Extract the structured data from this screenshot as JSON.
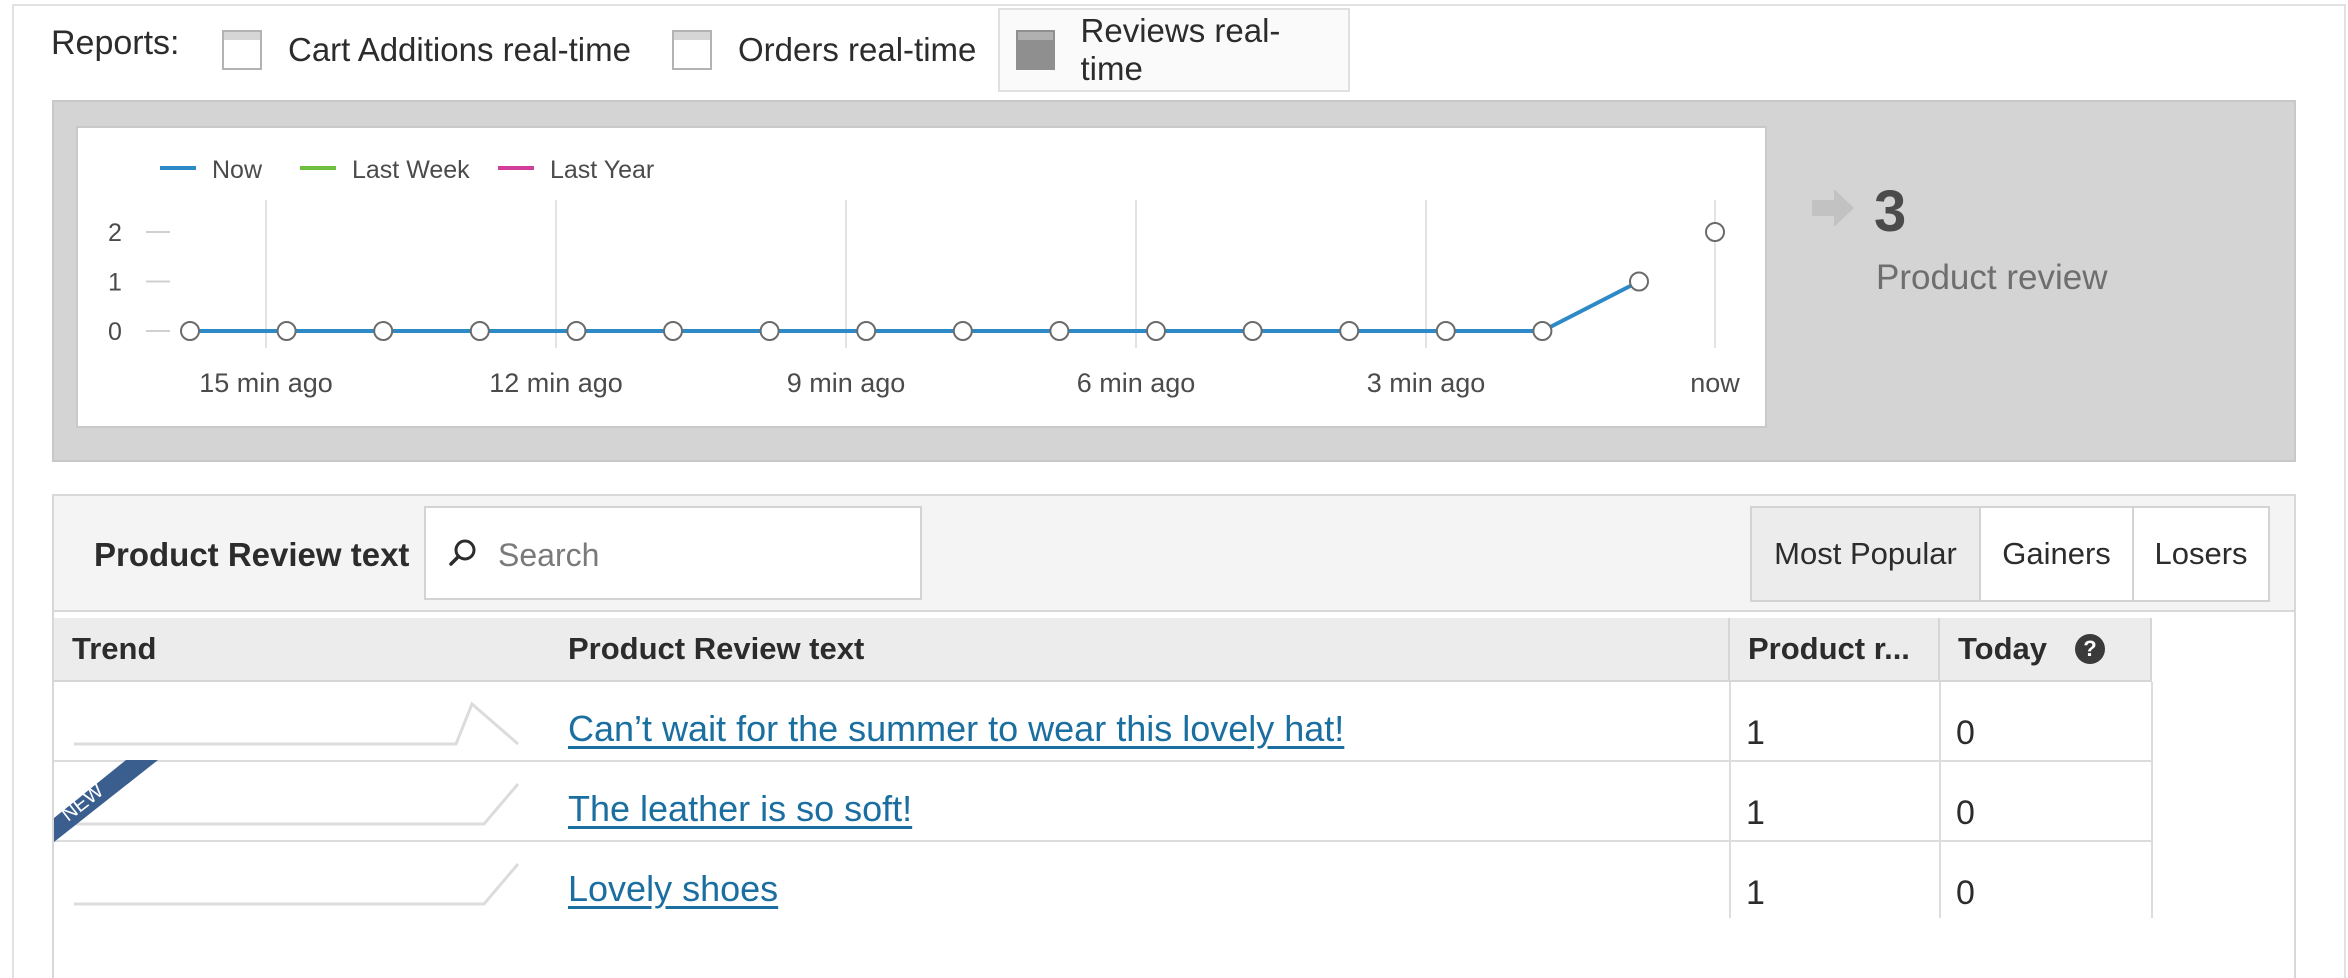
{
  "reports": {
    "label": "Reports:",
    "tabs": [
      {
        "label": "Cart Additions real-time",
        "active": false
      },
      {
        "label": "Orders real-time",
        "active": false
      },
      {
        "label": "Reviews real-time",
        "active": true
      }
    ]
  },
  "chart_data": {
    "type": "line",
    "legend": [
      {
        "name": "Now",
        "color": "#2d8ac6"
      },
      {
        "name": "Last Week",
        "color": "#6cbf3f"
      },
      {
        "name": "Last Year",
        "color": "#d13f9a"
      }
    ],
    "x_tick_labels": [
      "15 min ago",
      "12 min ago",
      "9 min ago",
      "6 min ago",
      "3 min ago",
      "now"
    ],
    "y_ticks": [
      0,
      1,
      2
    ],
    "series": [
      {
        "name": "Now",
        "values": [
          0,
          0,
          0,
          0,
          0,
          0,
          0,
          0,
          0,
          0,
          0,
          0,
          0,
          0,
          0,
          1
        ]
      }
    ],
    "now_marker_value": 2,
    "ylim": [
      0,
      2
    ]
  },
  "summary": {
    "value": "3",
    "label": "Product review",
    "icon": "arrow-right-icon"
  },
  "table": {
    "dimension_label": "Product Review text",
    "search_placeholder": "Search",
    "segments": [
      {
        "label": "Most Popular",
        "active": true
      },
      {
        "label": "Gainers",
        "active": false
      },
      {
        "label": "Losers",
        "active": false
      }
    ],
    "columns": [
      "Trend",
      "Product Review text",
      "Product r...",
      "Today"
    ],
    "help_icon": "?",
    "badge_text": "NEW",
    "rows": [
      {
        "text": "Can’t wait for the summer to wear this lovely hat!",
        "product_reviews": "1",
        "today": "0",
        "trend": "peak",
        "new": false
      },
      {
        "text": "The leather is so soft!",
        "product_reviews": "1",
        "today": "0",
        "trend": "rise",
        "new": true
      },
      {
        "text": "Lovely shoes",
        "product_reviews": "1",
        "today": "0",
        "trend": "rise",
        "new": false
      }
    ]
  }
}
